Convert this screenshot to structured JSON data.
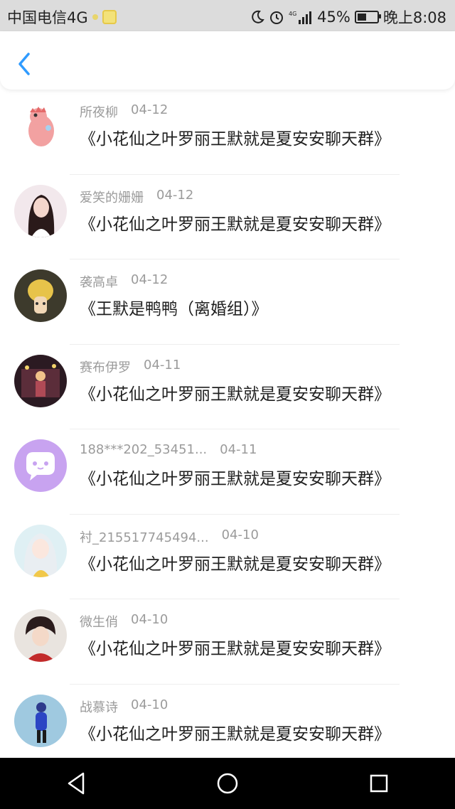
{
  "status_bar": {
    "carrier": "中国电信4G",
    "network": "4G",
    "battery": "45%",
    "battery_level": 0.45,
    "time": "晚上8:08"
  },
  "colors": {
    "accent": "#2f9bff",
    "meta_text": "#9b9b9b",
    "message_text": "#1f1f1f"
  },
  "list": [
    {
      "name": "所夜柳",
      "date": "04-12",
      "message": "《小花仙之叶罗丽王默就是夏安安聊天群》",
      "avatar": "pink-dinosaur-avatar"
    },
    {
      "name": "爱笑的姗姗",
      "date": "04-12",
      "message": "《小花仙之叶罗丽王默就是夏安安聊天群》",
      "avatar": "girl-photo-avatar"
    },
    {
      "name": "袭高卓",
      "date": "04-12",
      "message": "《王默是鸭鸭（离婚组）》",
      "avatar": "yellow-toy-avatar"
    },
    {
      "name": "赛布伊罗",
      "date": "04-11",
      "message": "《小花仙之叶罗丽王默就是夏安安聊天群》",
      "avatar": "night-scene-avatar"
    },
    {
      "name": "188***202_53451...",
      "date": "04-11",
      "message": "《小花仙之叶罗丽王默就是夏安安聊天群》",
      "avatar": "chat-bubble-avatar"
    },
    {
      "name": "衬_215517745494...",
      "date": "04-10",
      "message": "《小花仙之叶罗丽王默就是夏安安聊天群》",
      "avatar": "anime-girl-avatar"
    },
    {
      "name": "微生俏",
      "date": "04-10",
      "message": "《小花仙之叶罗丽王默就是夏安安聊天群》",
      "avatar": "anime-boy-avatar"
    },
    {
      "name": "战慕诗",
      "date": "04-10",
      "message": "《小花仙之叶罗丽王默就是夏安安聊天群》",
      "avatar": "blue-figure-avatar"
    }
  ]
}
